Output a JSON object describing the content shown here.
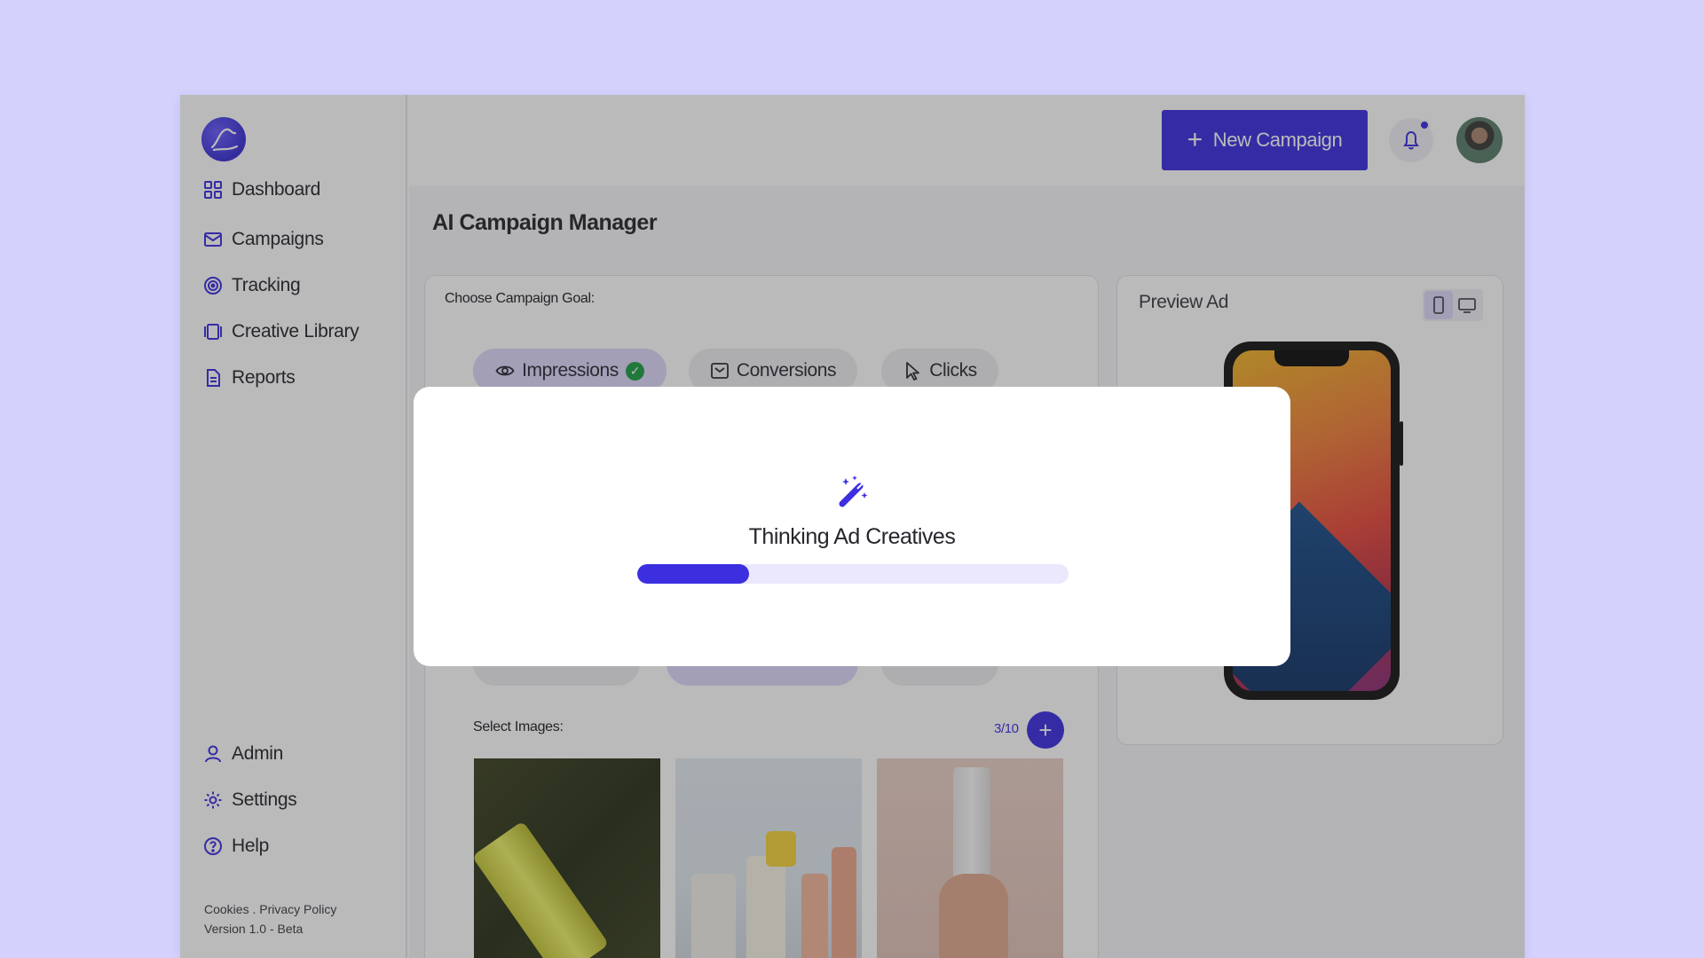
{
  "sidebar": {
    "nav": [
      {
        "label": "Dashboard",
        "icon": "grid-icon"
      },
      {
        "label": "Campaigns",
        "icon": "mail-icon"
      },
      {
        "label": "Tracking",
        "icon": "target-icon"
      },
      {
        "label": "Creative Library",
        "icon": "library-icon"
      },
      {
        "label": "Reports",
        "icon": "document-icon"
      }
    ],
    "bottom_nav": [
      {
        "label": "Admin",
        "icon": "user-icon"
      },
      {
        "label": "Settings",
        "icon": "gear-icon"
      },
      {
        "label": "Help",
        "icon": "help-icon"
      }
    ],
    "footer_links": "Cookies . Privacy Policy",
    "version": "Version 1.0 - Beta"
  },
  "header": {
    "new_campaign_label": "New Campaign",
    "has_notification": true
  },
  "main": {
    "title": "AI Campaign Manager",
    "goal_label": "Choose Campaign Goal:",
    "goals": [
      {
        "label": "Impressions",
        "selected": true,
        "icon": "eye-icon"
      },
      {
        "label": "Conversions",
        "selected": false,
        "icon": "checkbox-icon"
      },
      {
        "label": "Clicks",
        "selected": false,
        "icon": "cursor-icon"
      }
    ],
    "images_label": "Select Images:",
    "images_count": "3/10",
    "images": [
      {
        "name": "yellow-tube-product"
      },
      {
        "name": "skincare-bottles-product"
      },
      {
        "name": "hand-holding-bottle-product"
      }
    ]
  },
  "preview": {
    "title": "Preview Ad",
    "device": "mobile"
  },
  "modal": {
    "title": "Thinking Ad Creatives",
    "progress": 0.26
  },
  "colors": {
    "accent": "#3c2fe0",
    "page_bg": "#d4d2fc",
    "success": "#1e9e45",
    "chip_selected": "#dcd8fb"
  }
}
